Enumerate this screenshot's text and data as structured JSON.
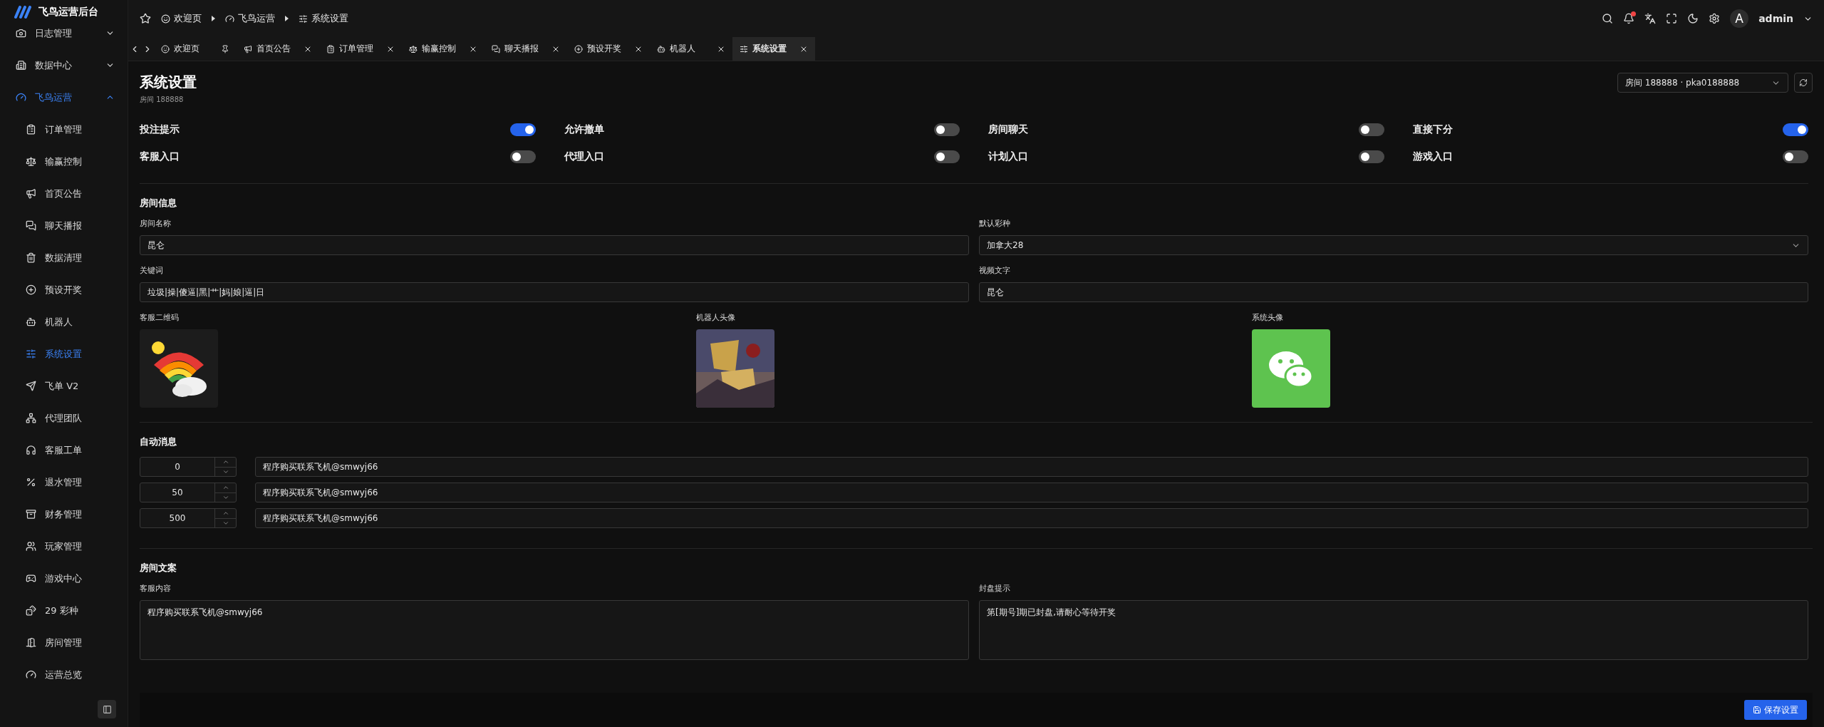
{
  "brand": {
    "title": "飞鸟运营后台"
  },
  "sidebar": {
    "items": [
      {
        "label": "日志管理",
        "expanded": false,
        "selected": false
      },
      {
        "label": "数据中心",
        "expanded": false,
        "selected": false
      },
      {
        "label": "飞鸟运营",
        "expanded": true,
        "selected": true,
        "children": [
          {
            "label": "订单管理",
            "selected": false
          },
          {
            "label": "输赢控制",
            "selected": false
          },
          {
            "label": "首页公告",
            "selected": false
          },
          {
            "label": "聊天播报",
            "selected": false
          },
          {
            "label": "数据清理",
            "selected": false
          },
          {
            "label": "预设开奖",
            "selected": false
          },
          {
            "label": "机器人",
            "selected": false
          },
          {
            "label": "系统设置",
            "selected": true
          },
          {
            "label": "飞单 V2",
            "selected": false
          },
          {
            "label": "代理团队",
            "selected": false
          },
          {
            "label": "客服工单",
            "selected": false
          },
          {
            "label": "退水管理",
            "selected": false
          },
          {
            "label": "财务管理",
            "selected": false
          },
          {
            "label": "玩家管理",
            "selected": false
          },
          {
            "label": "游戏中心",
            "selected": false
          },
          {
            "label": "29 彩种",
            "selected": false
          },
          {
            "label": "房间管理",
            "selected": false
          },
          {
            "label": "运营总览",
            "selected": false
          }
        ]
      }
    ]
  },
  "breadcrumb": [
    "欢迎页",
    "飞鸟运营",
    "系统设置"
  ],
  "header": {
    "notification": true,
    "avatar": "A",
    "user": "admin"
  },
  "tabs": [
    {
      "label": "欢迎页",
      "pinned": true,
      "selected": false
    },
    {
      "label": "首页公告",
      "pinned": false,
      "selected": false
    },
    {
      "label": "订单管理",
      "pinned": false,
      "selected": false
    },
    {
      "label": "输赢控制",
      "pinned": false,
      "selected": false
    },
    {
      "label": "聊天播报",
      "pinned": false,
      "selected": false
    },
    {
      "label": "预设开奖",
      "pinned": false,
      "selected": false
    },
    {
      "label": "机器人",
      "pinned": false,
      "selected": false
    },
    {
      "label": "系统设置",
      "pinned": false,
      "selected": true
    }
  ],
  "page": {
    "title": "系统设置",
    "subtitle": "房间 188888",
    "room_select": "房间 188888 · pka0188888"
  },
  "switches": [
    {
      "label": "投注提示",
      "on": true
    },
    {
      "label": "允许撤单",
      "on": false
    },
    {
      "label": "房间聊天",
      "on": false
    },
    {
      "label": "直接下分",
      "on": true
    },
    {
      "label": "客服入口",
      "on": false
    },
    {
      "label": "代理入口",
      "on": false
    },
    {
      "label": "计划入口",
      "on": false
    },
    {
      "label": "游戏入口",
      "on": false
    }
  ],
  "room_info": {
    "title": "房间信息",
    "fields": [
      {
        "label": "房间名称",
        "value": "昆仑",
        "kind": "text"
      },
      {
        "label": "默认彩种",
        "value": "加拿大28",
        "kind": "select"
      },
      {
        "label": "关键词",
        "value": "垃圾|操|傻逼|黑|艹|妈|娘|逼|日",
        "kind": "text"
      },
      {
        "label": "视频文字",
        "value": "昆仑",
        "kind": "text"
      }
    ],
    "images": [
      {
        "label": "客服二维码",
        "kind": "rainbow"
      },
      {
        "label": "机器人头像",
        "kind": "poster"
      },
      {
        "label": "系统头像",
        "kind": "chat"
      }
    ]
  },
  "auto_messages": {
    "title": "自动消息",
    "rows": [
      {
        "number": "0",
        "text": "程序购买联系飞机@smwyj66"
      },
      {
        "number": "50",
        "text": "程序购买联系飞机@smwyj66"
      },
      {
        "number": "500",
        "text": "程序购买联系飞机@smwyj66"
      }
    ]
  },
  "room_text": {
    "title": "房间文案",
    "fields": [
      {
        "label": "客服内容",
        "value": "程序购买联系飞机@smwyj66"
      },
      {
        "label": "封盘提示",
        "value": "第[期号]期已封盘,请耐心等待开奖"
      }
    ]
  },
  "save_button": "保存设置"
}
